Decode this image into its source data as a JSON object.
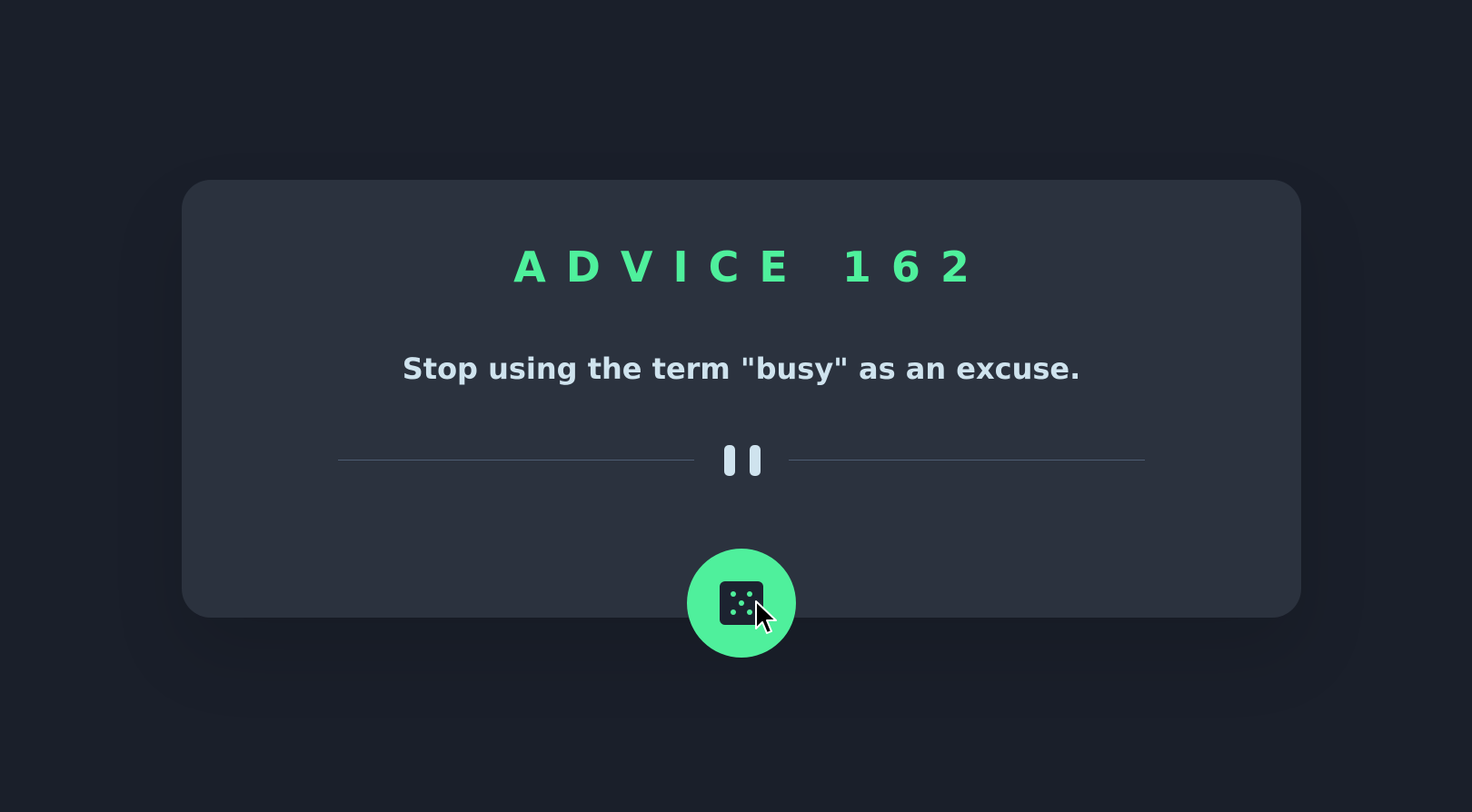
{
  "card": {
    "title": "ADVICE 162",
    "advice": "Stop using the term \"busy\" as an excuse."
  },
  "icons": {
    "divider": "pause-icon",
    "button": "dice-icon",
    "pointer": "mouse-cursor-icon"
  },
  "colors": {
    "background": "#1a1f2a",
    "card": "#2b323e",
    "accent": "#4ff09c",
    "text": "#cfe3ee",
    "divider": "#4e5d73"
  }
}
